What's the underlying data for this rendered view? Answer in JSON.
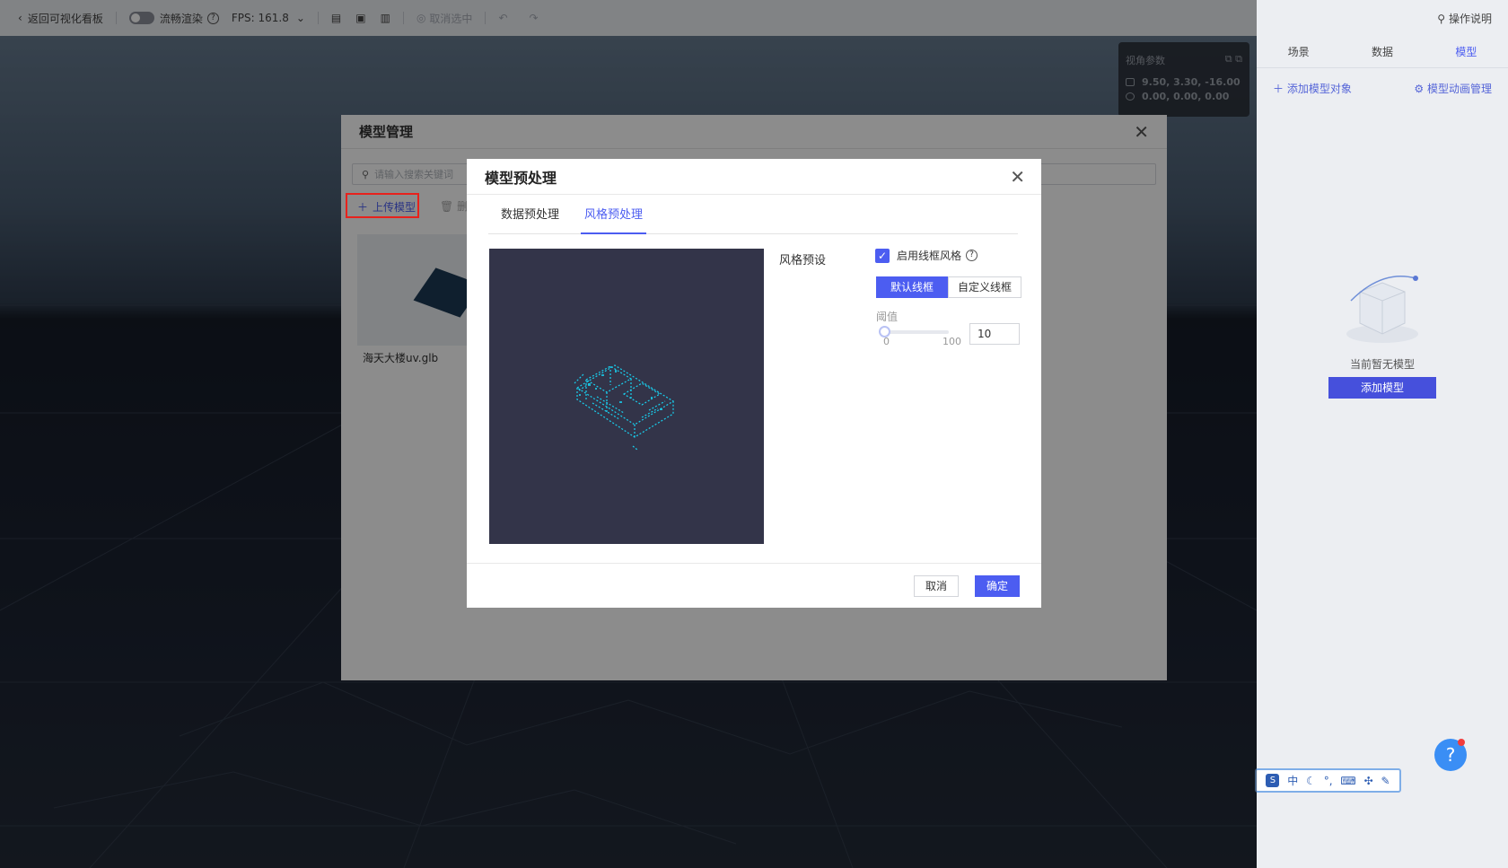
{
  "topbar": {
    "back_label": "返回可视化看板",
    "smooth_render_label": "流畅渲染",
    "fps_label": "FPS:",
    "fps_value": "161.8",
    "cancel_select_label": "取消选中",
    "help_label": "操作说明"
  },
  "view_params": {
    "title": "视角参数",
    "position": "9.50, 3.30, -16.00",
    "rotation": "0.00, 0.00, 0.00"
  },
  "right_panel": {
    "tabs": [
      "场景",
      "数据",
      "模型"
    ],
    "active_tab": "模型",
    "add_model_object_label": "添加模型对象",
    "model_anim_label": "模型动画管理",
    "empty_text": "当前暂无模型",
    "add_model_button": "添加模型"
  },
  "ime_bar": {
    "lang": "中"
  },
  "model_manager": {
    "title": "模型管理",
    "search_placeholder": "请输入搜索关键词",
    "upload_label": "上传模型",
    "delete_label": "删",
    "models": [
      {
        "name": "海天大楼uv.glb"
      }
    ]
  },
  "preprocess_dialog": {
    "title": "模型预处理",
    "tabs": [
      "数据预处理",
      "风格预处理"
    ],
    "active_tab": "风格预处理",
    "style_preset_label": "风格预设",
    "enable_wireframe_label": "启用线框风格",
    "enable_wireframe_checked": true,
    "segments": [
      "默认线框",
      "自定义线框"
    ],
    "active_segment": "默认线框",
    "threshold_label": "阈值",
    "slider_min": "0",
    "slider_max": "100",
    "threshold_value": "10",
    "cancel_label": "取消",
    "confirm_label": "确定"
  },
  "colors": {
    "accent": "#4c5df1",
    "highlight": "#e8211c",
    "preview_bg": "#333449",
    "wireframe": "#18d1f0"
  }
}
